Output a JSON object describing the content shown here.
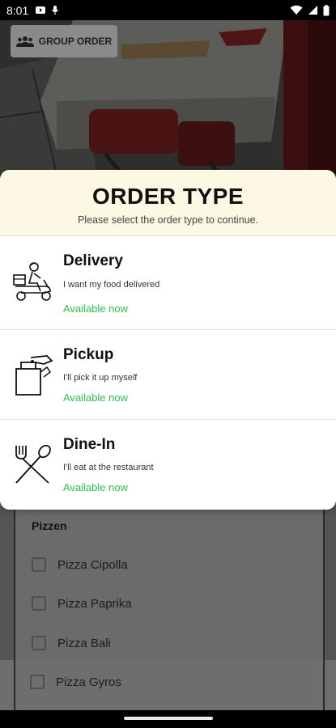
{
  "status_bar": {
    "time": "8:01",
    "icons": [
      "notification-icon",
      "mic-icon",
      "wifi-icon",
      "signal-icon",
      "battery-icon"
    ]
  },
  "header": {
    "group_order_label": "GROUP ORDER"
  },
  "modal": {
    "title": "ORDER TYPE",
    "subtitle": "Please select the order type to continue.",
    "options": [
      {
        "name": "Delivery",
        "description": "I want my food delivered",
        "availability": "Available now",
        "icon": "delivery-scooter-icon"
      },
      {
        "name": "Pickup",
        "description": "I'll pick it up myself",
        "availability": "Available now",
        "icon": "takeaway-bag-icon"
      },
      {
        "name": "Dine-In",
        "description": "I'll eat at the restaurant",
        "availability": "Available now",
        "icon": "fork-spoon-icon"
      }
    ]
  },
  "menu": {
    "category": "Pizzen",
    "items": [
      "Pizza Cipolla",
      "Pizza Paprika",
      "Pizza Bali",
      "Pizza Gyros"
    ]
  },
  "colors": {
    "header_bg": "#fcf8e3",
    "available_green": "#2ec44a",
    "overlay_dim": "#555555"
  }
}
